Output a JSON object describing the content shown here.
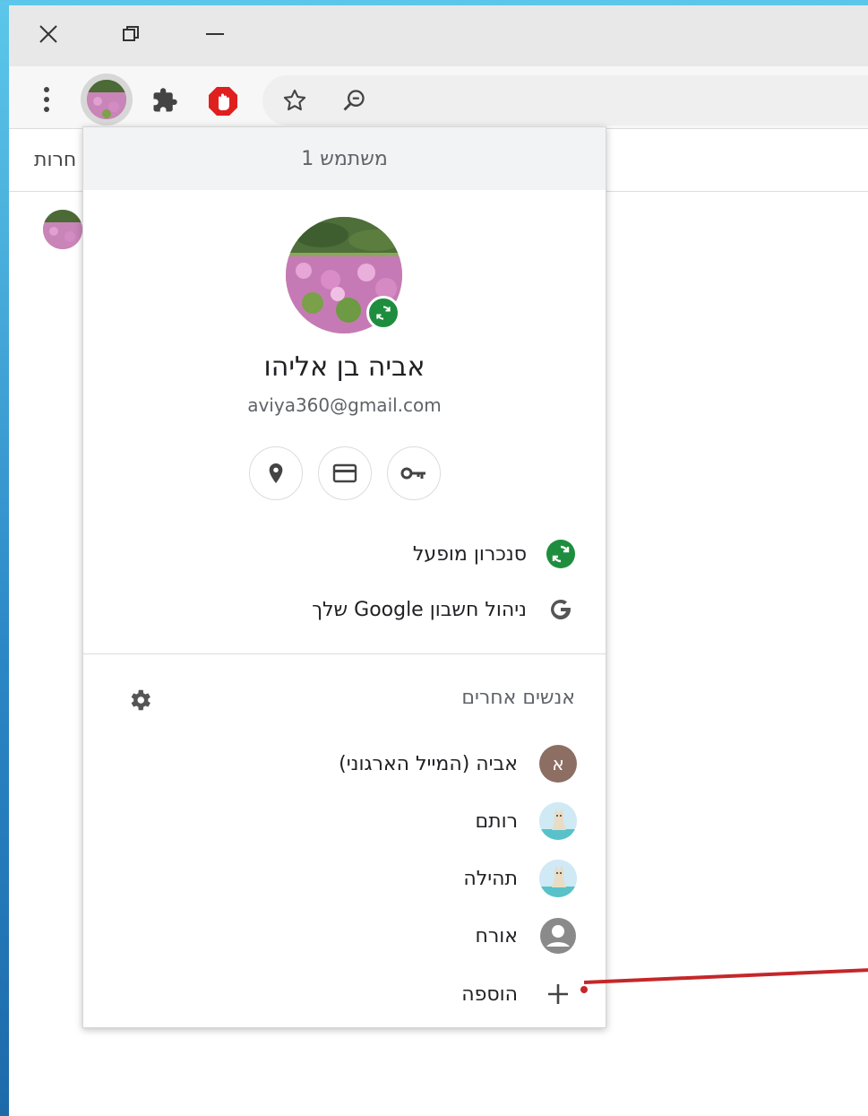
{
  "window": {
    "controls": [
      "close-icon",
      "restore-icon",
      "minimize-icon"
    ]
  },
  "toolbar": {
    "icons": [
      "menu-dots-icon",
      "profile-avatar",
      "extensions-puzzle-icon",
      "adblock-hand-icon",
      "star-icon",
      "zoom-icon"
    ]
  },
  "bookmarks": {
    "partial_label": "חרות"
  },
  "popup": {
    "header": "משתמש 1",
    "user_name": "אביה בן אליהו",
    "email": "aviya360@gmail.com",
    "quick_buttons": [
      "location-pin-icon",
      "credit-card-icon",
      "key-icon"
    ],
    "sync_label": "סנכרון מופעל",
    "manage_account_label": "ניהול חשבון Google שלך",
    "others_title": "אנשים אחרים",
    "profiles": [
      {
        "name": "אביה (המייל הארגוני)",
        "initial": "א",
        "color": "#8d6e63"
      },
      {
        "name": "רותם",
        "initial": "",
        "color": "#b3e0f2"
      },
      {
        "name": "תהילה",
        "initial": "",
        "color": "#b3e0f2"
      }
    ],
    "guest_label": "אורח",
    "add_label": "הוספה"
  },
  "colors": {
    "sync_green": "#1e8e3e",
    "arrow_red": "#c4272a"
  }
}
